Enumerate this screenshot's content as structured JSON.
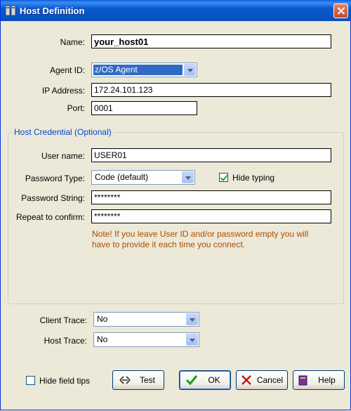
{
  "window": {
    "title": "Host Definition"
  },
  "name": {
    "label": "Name:",
    "value": "your_host01"
  },
  "agent_id": {
    "label": "Agent ID:",
    "value": "z/OS Agent"
  },
  "ip_address": {
    "label": "IP Address:",
    "value": "172.24.101.123"
  },
  "port": {
    "label": "Port:",
    "value": "0001"
  },
  "credential": {
    "group_title": "Host Credential (Optional)",
    "user_name": {
      "label": "User name:",
      "value": "USER01"
    },
    "password_type": {
      "label": "Password Type:",
      "value": "Code (default)"
    },
    "hide_typing": {
      "label": "Hide typing",
      "checked": true
    },
    "password_string": {
      "label": "Password String:",
      "value": "********"
    },
    "repeat_confirm": {
      "label": "Repeat to confirm:",
      "value": "********"
    },
    "note": "Note! If you leave User ID and/or password empty you will have to provide it each time you connect."
  },
  "client_trace": {
    "label": "Client Trace:",
    "value": "No"
  },
  "host_trace": {
    "label": "Host Trace:",
    "value": "No"
  },
  "hide_field_tips": {
    "label": "Hide field tips",
    "checked": false
  },
  "buttons": {
    "test": "Test",
    "ok": "OK",
    "cancel": "Cancel",
    "help": "Help"
  },
  "colors": {
    "title_bar": "#0a58d0",
    "group_title": "#0046d5",
    "note": "#b14a00",
    "selection": "#316ac5"
  }
}
